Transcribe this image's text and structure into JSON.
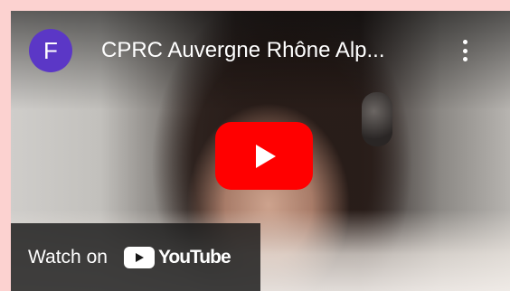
{
  "channel": {
    "avatar_letter": "F",
    "avatar_color": "#5b37c6",
    "title": "CPRC Auvergne Rhône Alp..."
  },
  "player": {
    "play_icon": "youtube-play-button",
    "accent": "#ff0000",
    "menu_icon": "more-vert-icon"
  },
  "watch_on": {
    "label": "Watch on",
    "brand": "YouTube"
  }
}
